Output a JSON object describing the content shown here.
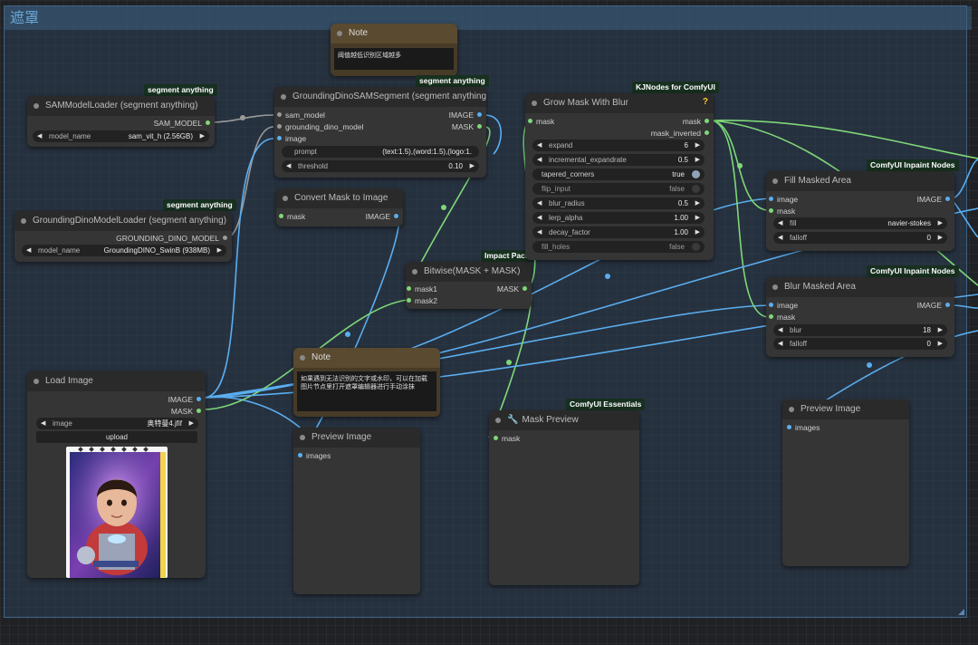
{
  "group": {
    "title": "遮罩"
  },
  "badges": {
    "sam_loader": "segment anything",
    "gd_segment": "segment anything",
    "gd_loader": "segment anything",
    "impact": "Impact Pack",
    "kjnodes": "KJNodes for ComfyUI",
    "inpaint1": "ComfyUI Inpaint Nodes",
    "inpaint2": "ComfyUI Inpaint Nodes",
    "essentials": "ComfyUI Essentials"
  },
  "nodes": {
    "note_top": {
      "title": "Note",
      "text": "阈值越低识别区域越多"
    },
    "sam_loader": {
      "title": "SAMModelLoader (segment anything)",
      "out": "SAM_MODEL",
      "w_label": "model_name",
      "w_value": "sam_vit_h (2.56GB)"
    },
    "gd_loader": {
      "title": "GroundingDinoModelLoader (segment anything)",
      "out": "GROUNDING_DINO_MODEL",
      "w_label": "model_name",
      "w_value": "GroundingDINO_SwinB (938MB)"
    },
    "gd_segment": {
      "title": "GroundingDinoSAMSegment (segment anything)",
      "in1": "sam_model",
      "in2": "grounding_dino_model",
      "in3": "image",
      "out1": "IMAGE",
      "out2": "MASK",
      "prompt_label": "prompt",
      "prompt_value": "(text:1.5),(word:1.5),(logo:1.",
      "thr_label": "threshold",
      "thr_value": "0.10"
    },
    "convert": {
      "title": "Convert Mask to Image",
      "in": "mask",
      "out": "IMAGE"
    },
    "bitwise": {
      "title": "Bitwise(MASK + MASK)",
      "in1": "mask1",
      "in2": "mask2",
      "out": "MASK"
    },
    "grow": {
      "title": "Grow Mask With Blur",
      "in": "mask",
      "out1": "mask",
      "out2": "mask_inverted",
      "widgets": [
        {
          "label": "expand",
          "value": "6"
        },
        {
          "label": "incremental_expandrate",
          "value": "0.5"
        },
        {
          "label": "tapered_corners",
          "value": "true"
        },
        {
          "label": "flip_input",
          "value": "false"
        },
        {
          "label": "blur_radius",
          "value": "0.5"
        },
        {
          "label": "lerp_alpha",
          "value": "1.00"
        },
        {
          "label": "decay_factor",
          "value": "1.00"
        },
        {
          "label": "fill_holes",
          "value": "false"
        }
      ],
      "help": "?"
    },
    "fill": {
      "title": "Fill Masked Area",
      "in1": "image",
      "in2": "mask",
      "out": "IMAGE",
      "fill_label": "fill",
      "fill_value": "navier-stokes",
      "falloff_label": "falloff",
      "falloff_value": "0"
    },
    "blur": {
      "title": "Blur Masked Area",
      "in1": "image",
      "in2": "mask",
      "out": "IMAGE",
      "blur_label": "blur",
      "blur_value": "18",
      "falloff_label": "falloff",
      "falloff_value": "0"
    },
    "load_image": {
      "title": "Load Image",
      "out1": "IMAGE",
      "out2": "MASK",
      "w_label": "image",
      "w_value": "奥特曼4.jfif",
      "upload": "upload"
    },
    "note_mid": {
      "title": "Note",
      "text": "如果遇到无法识别的文字或水印，可以在加载图片节点里打开遮罩编辑器进行手动涂抹"
    },
    "preview1": {
      "title": "Preview Image",
      "in": "images"
    },
    "mask_preview": {
      "title": "Mask Preview",
      "in": "mask"
    },
    "preview2": {
      "title": "Preview Image",
      "in": "images"
    }
  },
  "colors": {
    "mask_link": "#7ed878",
    "image_link": "#5aaef0",
    "model_link": "#9a9a9a"
  }
}
